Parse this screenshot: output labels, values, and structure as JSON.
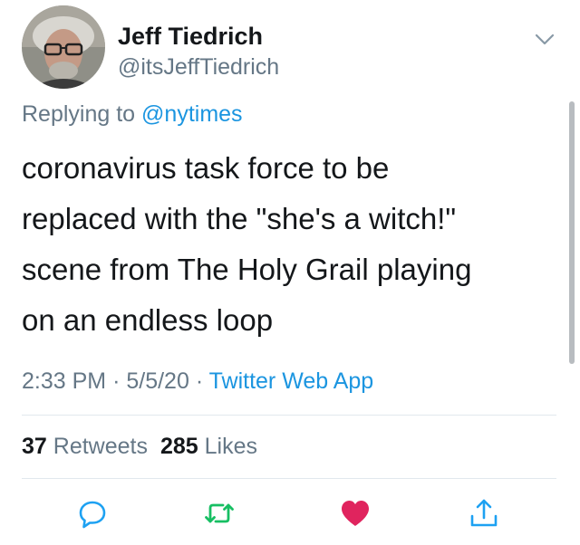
{
  "author": {
    "display_name": "Jeff Tiedrich",
    "handle": "@itsJeffTiedrich"
  },
  "reply_context": {
    "prefix": "Replying to",
    "mention": "@nytimes"
  },
  "tweet": {
    "lines": [
      "coronavirus task force to be",
      "replaced with the \"she's a witch!\"",
      "scene from The Holy Grail playing",
      "on an endless loop"
    ]
  },
  "meta": {
    "time": "2:33 PM",
    "date": "5/5/20",
    "separator": "·",
    "source": "Twitter Web App"
  },
  "stats": {
    "retweets_count": "37",
    "retweets_label": "Retweets",
    "likes_count": "285",
    "likes_label": "Likes"
  },
  "actions": [
    {
      "icon": "reply-icon",
      "color": "#1da1f2"
    },
    {
      "icon": "retweet-icon",
      "color": "#17bf63"
    },
    {
      "icon": "heart-icon",
      "color": "#e0245e",
      "active": true
    },
    {
      "icon": "share-icon",
      "color": "#1da1f2"
    }
  ],
  "colors": {
    "link": "#1b95e0",
    "secondary_text": "#657786",
    "primary_text": "#14171a",
    "divider": "#e1e8ed"
  }
}
